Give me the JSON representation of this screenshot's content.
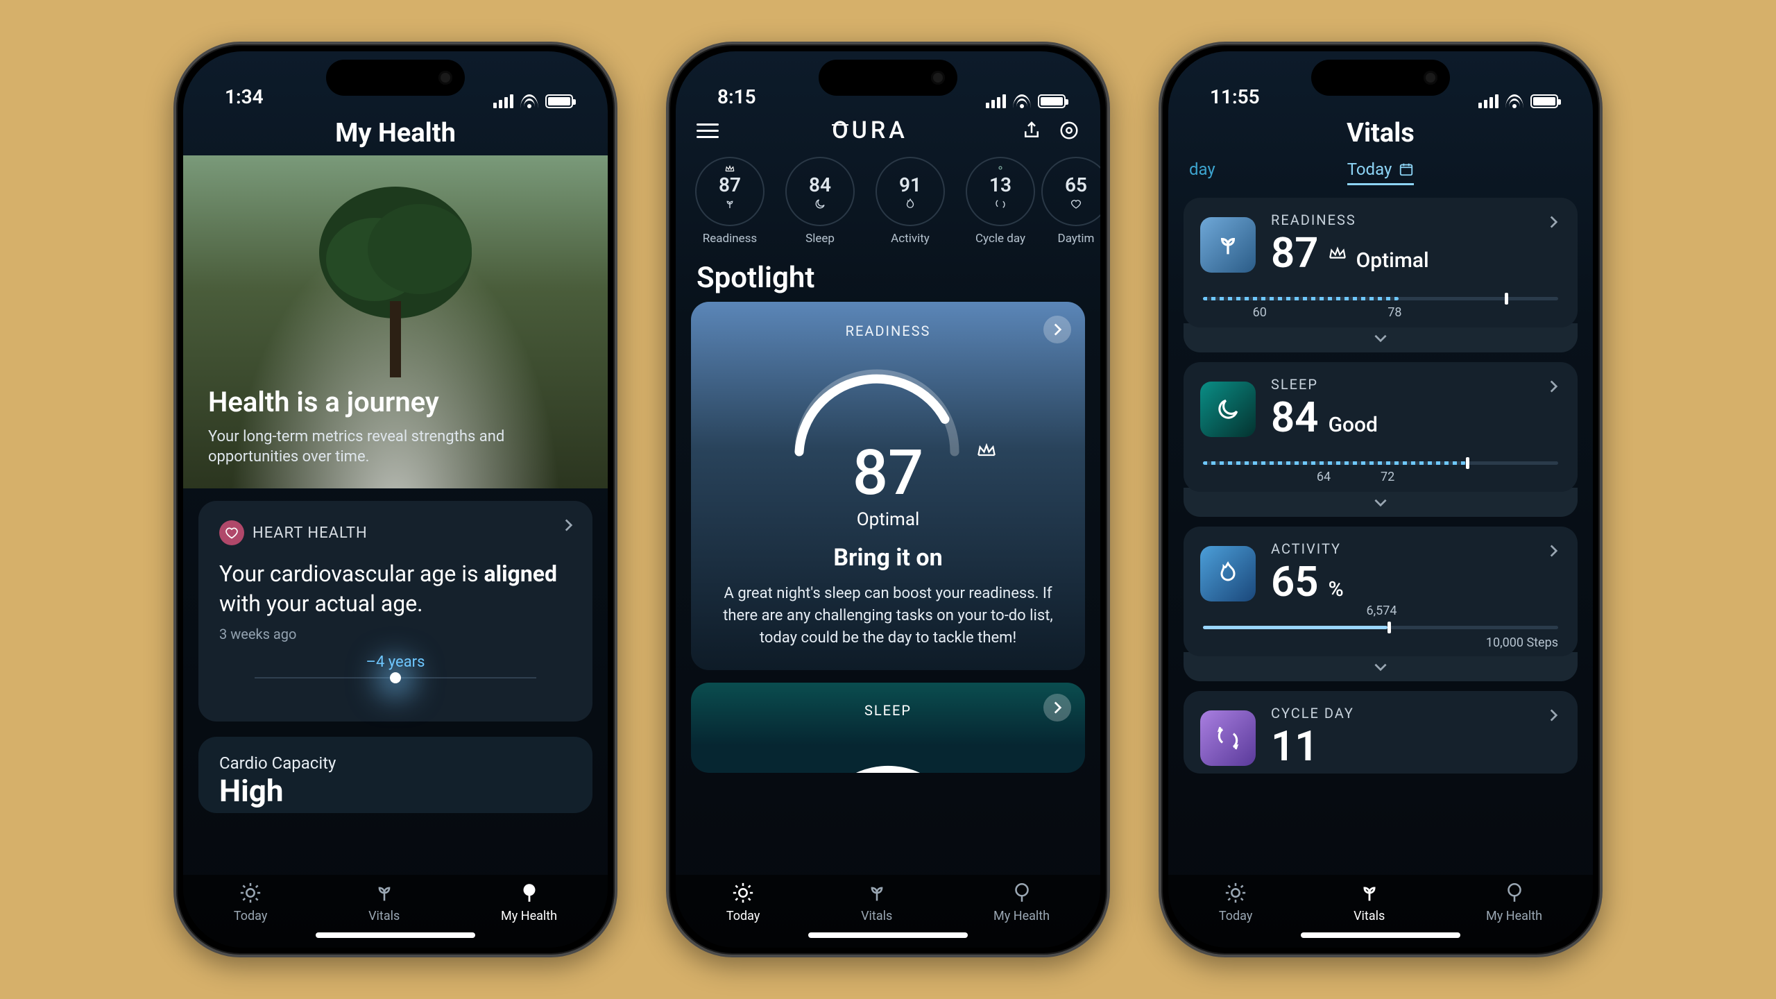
{
  "nav": {
    "today": "Today",
    "vitals": "Vitals",
    "myhealth": "My Health"
  },
  "p1": {
    "time": "1:34",
    "title": "My Health",
    "hero_h": "Health is a journey",
    "hero_p": "Your long-term metrics reveal strengths and opportunities over time.",
    "heart_label": "HEART HEALTH",
    "heart_msg_a": "Your cardiovascular age is ",
    "heart_msg_b": "aligned",
    "heart_msg_c": " with your actual age.",
    "heart_time": "3 weeks ago",
    "age_delta": "–4 years",
    "cap_label": "Cardio Capacity",
    "cap_value": "High"
  },
  "p2": {
    "time": "8:15",
    "brand": "OURA",
    "spotlight": "Spotlight",
    "rings": [
      {
        "v": "87",
        "l": "Readiness",
        "icon": "sprout"
      },
      {
        "v": "84",
        "l": "Sleep",
        "icon": "moon"
      },
      {
        "v": "91",
        "l": "Activity",
        "icon": "flame"
      },
      {
        "v": "13",
        "l": "Cycle day",
        "icon": "loop"
      },
      {
        "v": "65",
        "l": "Daytim",
        "icon": "heart"
      }
    ],
    "card1": {
      "cat": "READINESS",
      "score": "87",
      "state": "Optimal",
      "h": "Bring it on",
      "p": "A great night's sleep can boost your readiness. If there are any challenging tasks on your to-do list, today could be the day to tackle them!"
    },
    "card2": {
      "cat": "SLEEP"
    }
  },
  "p3": {
    "time": "11:55",
    "title": "Vitals",
    "prev_day": "day",
    "today": "Today",
    "readiness": {
      "cat": "READINESS",
      "v": "87",
      "state": "Optimal",
      "t1": "60",
      "t2": "78"
    },
    "sleep": {
      "cat": "SLEEP",
      "v": "84",
      "state": "Good",
      "t1": "64",
      "t2": "72"
    },
    "activity": {
      "cat": "ACTIVITY",
      "v": "65",
      "unit": "%",
      "cur": "6,574",
      "goal": "10,000 Steps"
    },
    "cycle": {
      "cat": "CYCLE DAY",
      "v": "11"
    }
  },
  "chart_data": {
    "type": "table",
    "title": "Oura ring scores",
    "series": [
      {
        "name": "Readiness",
        "value": 87,
        "status": "Optimal",
        "range_markers": [
          60,
          78
        ]
      },
      {
        "name": "Sleep",
        "value": 84,
        "status": "Good",
        "range_markers": [
          64,
          72
        ]
      },
      {
        "name": "Activity",
        "value": 65,
        "unit": "%",
        "steps_current": 6574,
        "steps_goal": 10000
      },
      {
        "name": "Cycle day",
        "value": 11
      }
    ],
    "readiness_gauge": {
      "type": "gauge",
      "value": 87,
      "min": 0,
      "max": 100,
      "label": "Optimal"
    }
  }
}
